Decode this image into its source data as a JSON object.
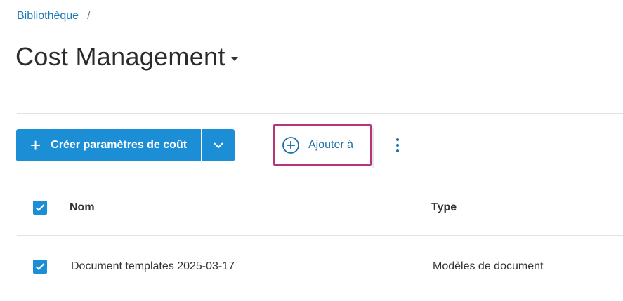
{
  "breadcrumb": {
    "root": "Bibliothèque",
    "separator": "/"
  },
  "header": {
    "title": "Cost Management"
  },
  "toolbar": {
    "create_label": "Créer paramètres de coût",
    "add_label": "Ajouter à"
  },
  "table": {
    "columns": [
      "Nom",
      "Type"
    ],
    "rows": [
      {
        "name": "Document templates 2025-03-17",
        "type": "Modèles de document",
        "checked": true
      }
    ]
  },
  "colors": {
    "accent": "#1b8ed6",
    "highlight": "#b5357a",
    "link": "#1a76b8"
  }
}
